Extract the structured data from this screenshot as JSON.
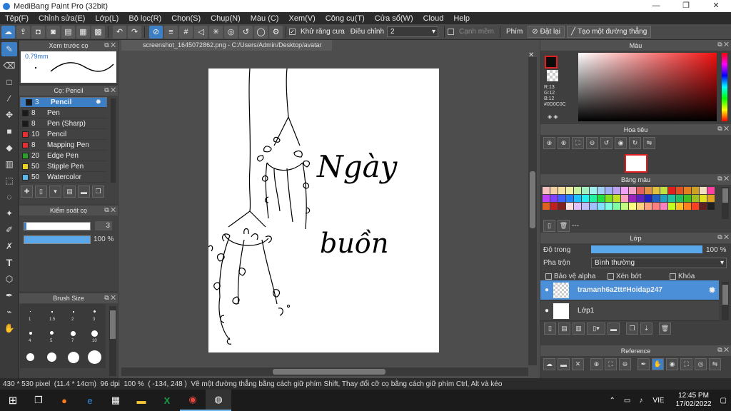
{
  "window": {
    "title": "MediBang Paint Pro (32bit)",
    "minimize": "—",
    "maximize": "❐",
    "close": "✕"
  },
  "menu": [
    "Tệp(F)",
    "Chỉnh sửa(E)",
    "Lớp(L)",
    "Bộ lọc(R)",
    "Chọn(S)",
    "Chụp(N)",
    "Màu (C)",
    "Xem(V)",
    "Công cụ(T)",
    "Cửa sổ(W)",
    "Cloud",
    "Help"
  ],
  "toolbar": {
    "antialias_label": "Khử răng cưa",
    "correction_label": "Điều chỉnh",
    "correction_value": "2",
    "soft_edge_label": "Cạnh mềm",
    "key_label": "Phím",
    "reset_label": "Đặt lại",
    "straight_line_label": "Tạo một đường thẳng"
  },
  "preview_panel": {
    "title": "Xem trước cọ",
    "size_label": "0.79mm"
  },
  "brush_panel": {
    "title": "Cọ: Pencil",
    "items": [
      {
        "size": "3",
        "name": "Pencil",
        "color": "#1a1a1a",
        "selected": true
      },
      {
        "size": "8",
        "name": "Pen",
        "color": "#1a1a1a"
      },
      {
        "size": "8",
        "name": "Pen (Sharp)",
        "color": "#1a1a1a"
      },
      {
        "size": "10",
        "name": "Pencil",
        "color": "#e03030"
      },
      {
        "size": "8",
        "name": "Mapping Pen",
        "color": "#e03030"
      },
      {
        "size": "20",
        "name": "Edge Pen",
        "color": "#2aa02a"
      },
      {
        "size": "50",
        "name": "Stipple Pen",
        "color": "#e8d020"
      },
      {
        "size": "50",
        "name": "Watercolor",
        "color": "#5ab8e8"
      }
    ]
  },
  "brush_control": {
    "title": "Kiểm soát cọ",
    "size_value": "3",
    "opacity_value": "100 %"
  },
  "brush_size": {
    "title": "Brush Size",
    "labels": [
      "1",
      "1.5",
      "2",
      "3",
      "4",
      "5",
      "7",
      "10"
    ]
  },
  "document": {
    "tab": "screenshot_1645072862.png - C:/Users/Admin/Desktop/avatar",
    "text_line1": "Ngày",
    "text_line2": "buồn"
  },
  "color_panel": {
    "title": "Màu",
    "r": "R:13",
    "g": "G:12",
    "b": "B:12",
    "hex": "#0D0C0C",
    "primary": "#0d0c0c"
  },
  "navigator": {
    "title": "Hoa tiêu"
  },
  "palette": {
    "title": "Bảng màu",
    "swatches": [
      "#f5c0c0",
      "#f5d0a0",
      "#f5e0a0",
      "#f0f0a0",
      "#c8f0a0",
      "#a0f0c0",
      "#a0f0f0",
      "#a0d0f5",
      "#a0b0f5",
      "#c0a0f5",
      "#f0a0f5",
      "#f5a0c8",
      "#e06060",
      "#e09040",
      "#e0c040",
      "#c0e040",
      "#e02020",
      "#e05020",
      "#e08020",
      "#d0a020",
      "#f0e0c0",
      "#ff40a0",
      "#c040ff",
      "#8040ff",
      "#4060ff",
      "#2080ff",
      "#20c0ff",
      "#20f0f0",
      "#20f0a0",
      "#20e040",
      "#80e020",
      "#c0e020",
      "#ffa0c0",
      "#a020c0",
      "#6020c0",
      "#2020c0",
      "#2060c0",
      "#20a0c0",
      "#20c0a0",
      "#20c060",
      "#40c020",
      "#a0c020",
      "#e0e020",
      "#e0a020",
      "#e06020",
      "#c02020",
      "#802020",
      "#ffe0e0",
      "#e0c0ff",
      "#c0c0ff",
      "#a0c0ff",
      "#80e0ff",
      "#80ffe0",
      "#80ffa0",
      "#c0ff80",
      "#ffff80",
      "#ffd080",
      "#ffa080",
      "#ff8080",
      "#ff80c0",
      "#c0ff20",
      "#ffc020",
      "#ff8020",
      "#ff4020",
      "#602020",
      "#202020"
    ],
    "page": "---"
  },
  "layers": {
    "title": "Lớp",
    "opacity_label": "Độ trong",
    "opacity_value": "100 %",
    "blend_label": "Pha trộn",
    "blend_value": "Bình thường",
    "protect_alpha": "Bảo vệ alpha",
    "clipping": "Xén bớt",
    "lock": "Khóa",
    "items": [
      {
        "name": "tramanh6a2tt#Hoidap247",
        "selected": true
      },
      {
        "name": "Lớp1",
        "selected": false
      }
    ]
  },
  "reference": {
    "title": "Reference"
  },
  "statusbar": {
    "size": "430 * 530 pixel",
    "cm": "(11.4 * 14cm)",
    "dpi": "96 dpi",
    "zoom": "100 %",
    "coords": "( -134, 248 )",
    "hint": "Vẽ một đường thẳng bằng cách giữ phím Shift, Thay đổi cỡ cọ bằng cách giữ phím Ctrl, Alt và kéo"
  },
  "taskbar": {
    "lang": "VIE",
    "time": "12:45 PM",
    "date": "17/02/2022"
  }
}
